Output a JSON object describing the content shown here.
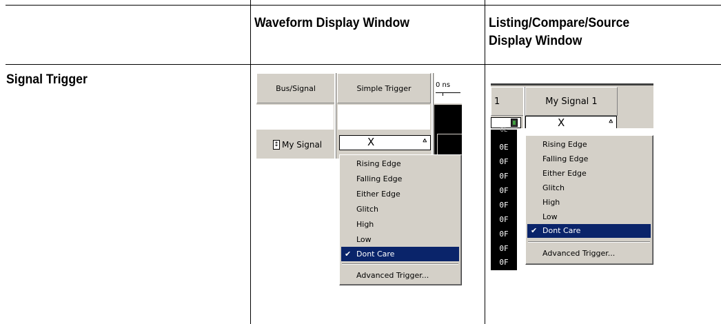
{
  "table": {
    "header_waveform": "Waveform Display Window",
    "header_listing_line1": "Listing/Compare/Source",
    "header_listing_line2": "Display Window",
    "row_label": "Signal Trigger"
  },
  "waveform_window": {
    "col_bus_signal": "Bus/Signal",
    "col_simple_trigger": "Simple Trigger",
    "time_label": "0 ns",
    "signal_name": "My Signal",
    "combo_value": "X",
    "menu_items": [
      "Rising Edge",
      "Falling Edge",
      "Either Edge",
      "Glitch",
      "High",
      "Low",
      "Dont Care"
    ],
    "selected_item": "Dont Care",
    "advanced_item": "Advanced Trigger..."
  },
  "listing_window": {
    "col_index": "1",
    "col_signal": "My Signal 1",
    "combo_value": "X",
    "hex_values": [
      "0E",
      "0F",
      "0F",
      "0F",
      "0F",
      "0F",
      "0F",
      "0F",
      "0F"
    ],
    "menu_items": [
      "Rising Edge",
      "Falling Edge",
      "Either Edge",
      "Glitch",
      "High",
      "Low",
      "Dont Care"
    ],
    "selected_item": "Dont Care",
    "advanced_item": "Advanced Trigger..."
  },
  "icons": {
    "check": "check-icon",
    "dropdown": "chevron-down-icon",
    "calculator": "calculator-icon",
    "updown": "up-down-arrow-icon"
  },
  "colors": {
    "menu_highlight": "#0a246a",
    "face": "#d4d0c8"
  }
}
